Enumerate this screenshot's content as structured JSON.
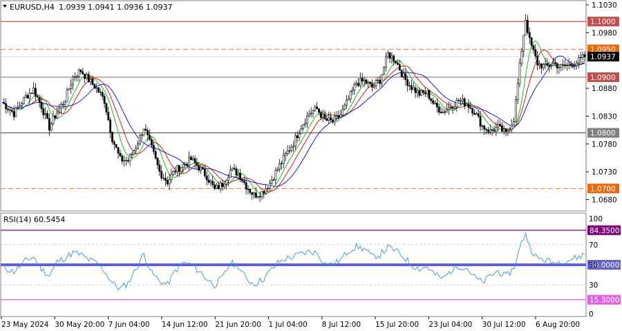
{
  "header": {
    "symbol": "EURUSD,H4",
    "ohlc": "1.0939 1.0941 1.0936 1.0937",
    "indicator": "RSI(14) 60.5454"
  },
  "colors": {
    "candle": "#000000",
    "ma_fast": "#00c000",
    "ma_mid": "#e00000",
    "ma_slow": "#0000e0",
    "level_solid_red": "#c0504d",
    "level_dashed": "#e07840",
    "level_solid_brown": "#a07070",
    "level_grey": "#606060",
    "rsi_line": "#3a8fe0",
    "rsi_50": "#6060d0",
    "rsi_upper": "#800080",
    "rsi_lower": "#e060e0"
  },
  "chart_data": [
    {
      "type": "candlestick",
      "symbol": "EURUSD",
      "timeframe": "H4",
      "ylim": [
        1.0662,
        1.1035
      ],
      "y_ticks": [
        "1.1030",
        "1.0980",
        "1.0880",
        "1.0830",
        "1.0780",
        "1.0730",
        "1.0680"
      ],
      "x_ticks": [
        "23 May 2024",
        "30 May 20:00",
        "7 Jun 04:00",
        "14 Jun 12:00",
        "21 Jun 20:00",
        "1 Jul 04:00",
        "8 Jul 12:00",
        "15 Jul 20:00",
        "23 Jul 04:00",
        "30 Jul 12:00",
        "6 Aug 20:00"
      ],
      "levels": [
        {
          "value": 1.1,
          "label": "1.1000",
          "style": "solid",
          "tag_color": "#c0504d"
        },
        {
          "value": 1.095,
          "label": "1.0950",
          "style": "dashed",
          "tag_color": "#e86a10"
        },
        {
          "value": 1.09,
          "label": "1.0900",
          "style": "solid",
          "tag_color": "#c0504d"
        },
        {
          "value": 1.08,
          "label": "1.0800",
          "style": "solid",
          "tag_color": "#808080"
        },
        {
          "value": 1.07,
          "label": "1.0700",
          "style": "dashed",
          "tag_color": "#e86a10"
        }
      ],
      "current_price": {
        "value": 1.0937,
        "label": "1.0937"
      },
      "close_path": [
        [
          0,
          1.0855
        ],
        [
          6,
          1.0835
        ],
        [
          12,
          1.0865
        ],
        [
          16,
          1.0878
        ],
        [
          20,
          1.0848
        ],
        [
          24,
          1.081
        ],
        [
          28,
          1.0838
        ],
        [
          32,
          1.086
        ],
        [
          36,
          1.09
        ],
        [
          40,
          1.0912
        ],
        [
          44,
          1.0895
        ],
        [
          48,
          1.088
        ],
        [
          52,
          1.0858
        ],
        [
          56,
          1.079
        ],
        [
          60,
          1.0752
        ],
        [
          64,
          1.075
        ],
        [
          68,
          1.0775
        ],
        [
          72,
          1.081
        ],
        [
          76,
          1.0772
        ],
        [
          80,
          1.073
        ],
        [
          84,
          1.0712
        ],
        [
          88,
          1.0733
        ],
        [
          92,
          1.0742
        ],
        [
          96,
          1.0752
        ],
        [
          100,
          1.0738
        ],
        [
          104,
          1.0722
        ],
        [
          108,
          1.0698
        ],
        [
          112,
          1.0708
        ],
        [
          116,
          1.0733
        ],
        [
          120,
          1.0728
        ],
        [
          124,
          1.0705
        ],
        [
          128,
          1.0688
        ],
        [
          132,
          1.0693
        ],
        [
          136,
          1.071
        ],
        [
          140,
          1.0735
        ],
        [
          144,
          1.076
        ],
        [
          148,
          1.0782
        ],
        [
          152,
          1.0812
        ],
        [
          156,
          1.0835
        ],
        [
          160,
          1.0843
        ],
        [
          164,
          1.0823
        ],
        [
          168,
          1.082
        ],
        [
          172,
          1.0832
        ],
        [
          176,
          1.086
        ],
        [
          180,
          1.089
        ],
        [
          184,
          1.0893
        ],
        [
          188,
          1.0882
        ],
        [
          192,
          1.0895
        ],
        [
          196,
          1.0942
        ],
        [
          200,
          1.093
        ],
        [
          204,
          1.09
        ],
        [
          208,
          1.0882
        ],
        [
          212,
          1.087
        ],
        [
          216,
          1.0872
        ],
        [
          220,
          1.0848
        ],
        [
          224,
          1.0838
        ],
        [
          228,
          1.0848
        ],
        [
          232,
          1.0858
        ],
        [
          236,
          1.0853
        ],
        [
          240,
          1.0838
        ],
        [
          244,
          1.0812
        ],
        [
          248,
          1.0803
        ],
        [
          252,
          1.081
        ],
        [
          256,
          1.0798
        ],
        [
          260,
          1.0825
        ],
        [
          264,
          1.095
        ],
        [
          266,
          1.1005
        ],
        [
          268,
          1.0965
        ],
        [
          272,
          1.0925
        ],
        [
          276,
          1.0918
        ],
        [
          280,
          1.0925
        ],
        [
          284,
          1.0918
        ],
        [
          288,
          1.0922
        ],
        [
          292,
          1.0927
        ],
        [
          296,
          1.0937
        ]
      ]
    },
    {
      "type": "line",
      "title": "RSI(14) 60.5454",
      "ylim": [
        0,
        100
      ],
      "y_ticks": [
        "100",
        "70",
        "50",
        "30",
        "0"
      ],
      "levels": [
        {
          "value": 84.35,
          "label": "84.3500",
          "tag_color": "#800080"
        },
        {
          "value": 50.0,
          "label": "50.0000",
          "tag_color": "#6060d0"
        },
        {
          "value": 15.3,
          "label": "15.3000",
          "tag_color": "#e060e0"
        }
      ],
      "series": [
        {
          "name": "RSI(14)",
          "x": [
            0,
            6,
            12,
            16,
            20,
            24,
            28,
            32,
            36,
            40,
            44,
            48,
            52,
            56,
            60,
            64,
            68,
            72,
            76,
            80,
            84,
            88,
            92,
            96,
            100,
            104,
            108,
            112,
            116,
            120,
            124,
            128,
            132,
            136,
            140,
            144,
            148,
            152,
            156,
            160,
            164,
            168,
            172,
            176,
            180,
            184,
            188,
            192,
            196,
            200,
            204,
            208,
            212,
            216,
            220,
            224,
            228,
            232,
            236,
            240,
            244,
            248,
            252,
            256,
            260,
            264,
            266,
            268,
            272,
            276,
            280,
            284,
            288,
            292,
            296
          ],
          "values": [
            48,
            43,
            54,
            58,
            46,
            39,
            53,
            57,
            62,
            60,
            55,
            52,
            44,
            32,
            26,
            32,
            46,
            61,
            42,
            34,
            30,
            44,
            52,
            50,
            44,
            36,
            30,
            37,
            52,
            49,
            36,
            31,
            35,
            43,
            52,
            56,
            58,
            61,
            63,
            62,
            51,
            50,
            55,
            64,
            68,
            66,
            58,
            60,
            67,
            64,
            58,
            50,
            46,
            48,
            40,
            36,
            44,
            49,
            47,
            38,
            32,
            39,
            44,
            38,
            47,
            72,
            82,
            68,
            56,
            55,
            52,
            53,
            55,
            57,
            60.5
          ]
        }
      ]
    }
  ]
}
